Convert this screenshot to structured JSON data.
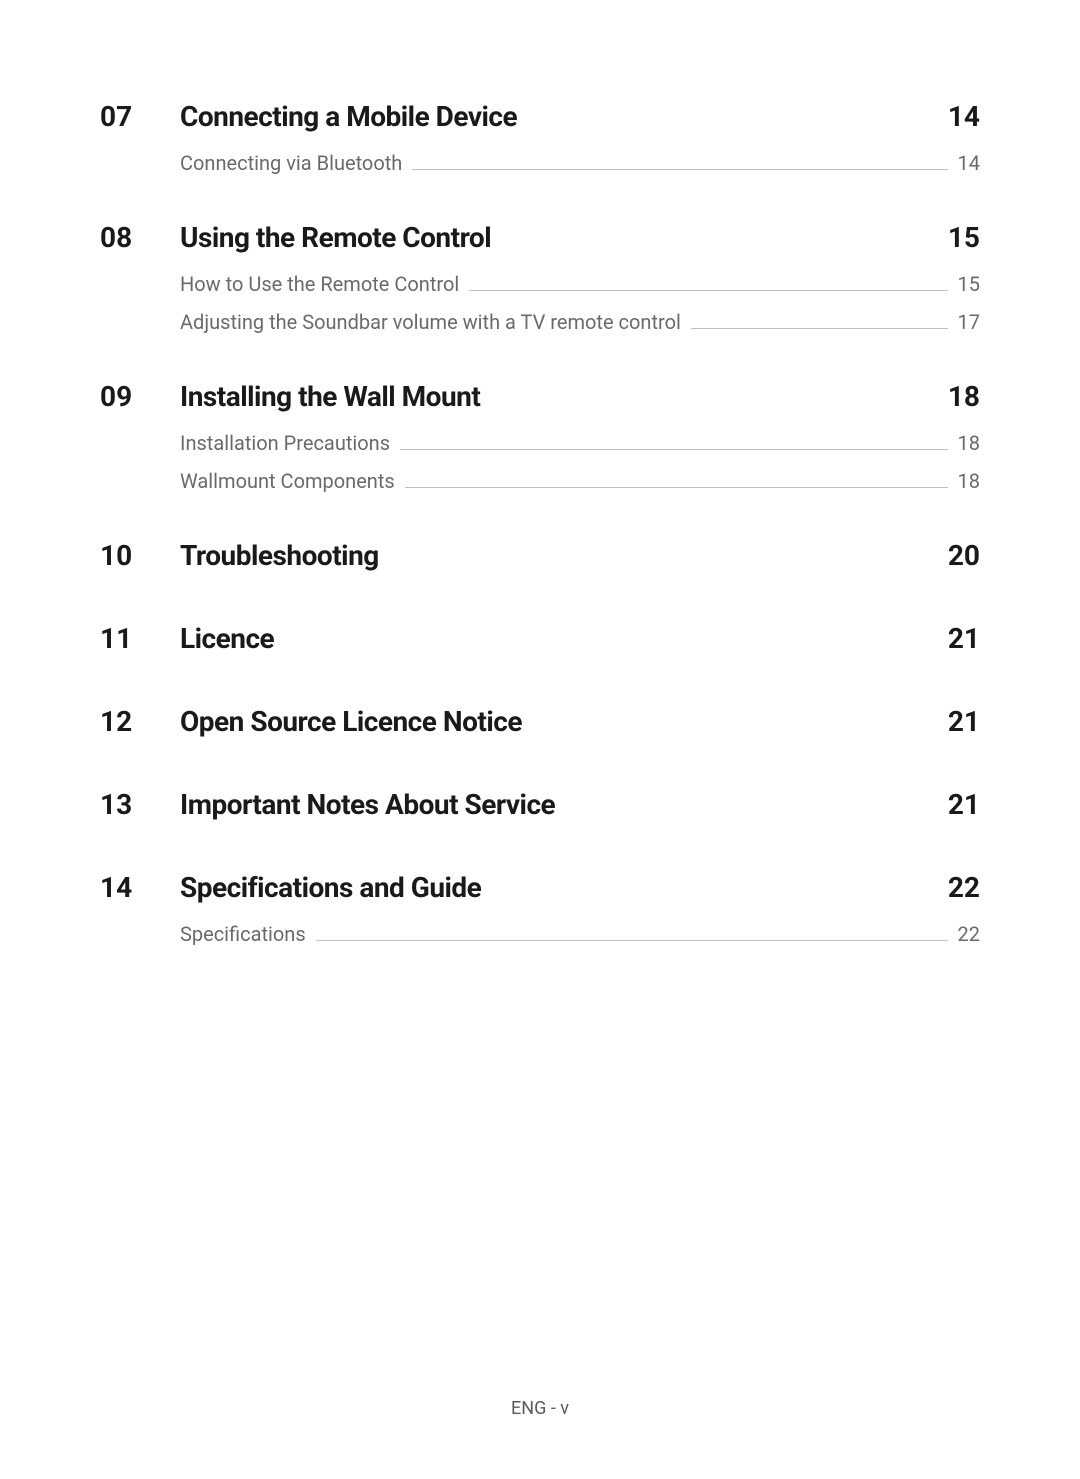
{
  "sections": [
    {
      "number": "07",
      "title": "Connecting a Mobile Device",
      "page": "14",
      "subs": [
        {
          "title": "Connecting via Bluetooth",
          "page": "14"
        }
      ]
    },
    {
      "number": "08",
      "title": "Using the Remote Control",
      "page": "15",
      "subs": [
        {
          "title": "How to Use the Remote Control",
          "page": "15"
        },
        {
          "title": "Adjusting the Soundbar volume with a TV remote control",
          "page": "17"
        }
      ]
    },
    {
      "number": "09",
      "title": "Installing the Wall Mount",
      "page": "18",
      "subs": [
        {
          "title": "Installation Precautions",
          "page": "18"
        },
        {
          "title": "Wallmount Components",
          "page": "18"
        }
      ]
    },
    {
      "number": "10",
      "title": "Troubleshooting",
      "page": "20",
      "subs": []
    },
    {
      "number": "11",
      "title": "Licence",
      "page": "21",
      "subs": []
    },
    {
      "number": "12",
      "title": "Open Source Licence Notice",
      "page": "21",
      "subs": []
    },
    {
      "number": "13",
      "title": "Important Notes About Service",
      "page": "21",
      "subs": []
    },
    {
      "number": "14",
      "title": "Specifications and Guide",
      "page": "22",
      "subs": [
        {
          "title": "Specifications",
          "page": "22"
        }
      ]
    }
  ],
  "footer": "ENG - v"
}
